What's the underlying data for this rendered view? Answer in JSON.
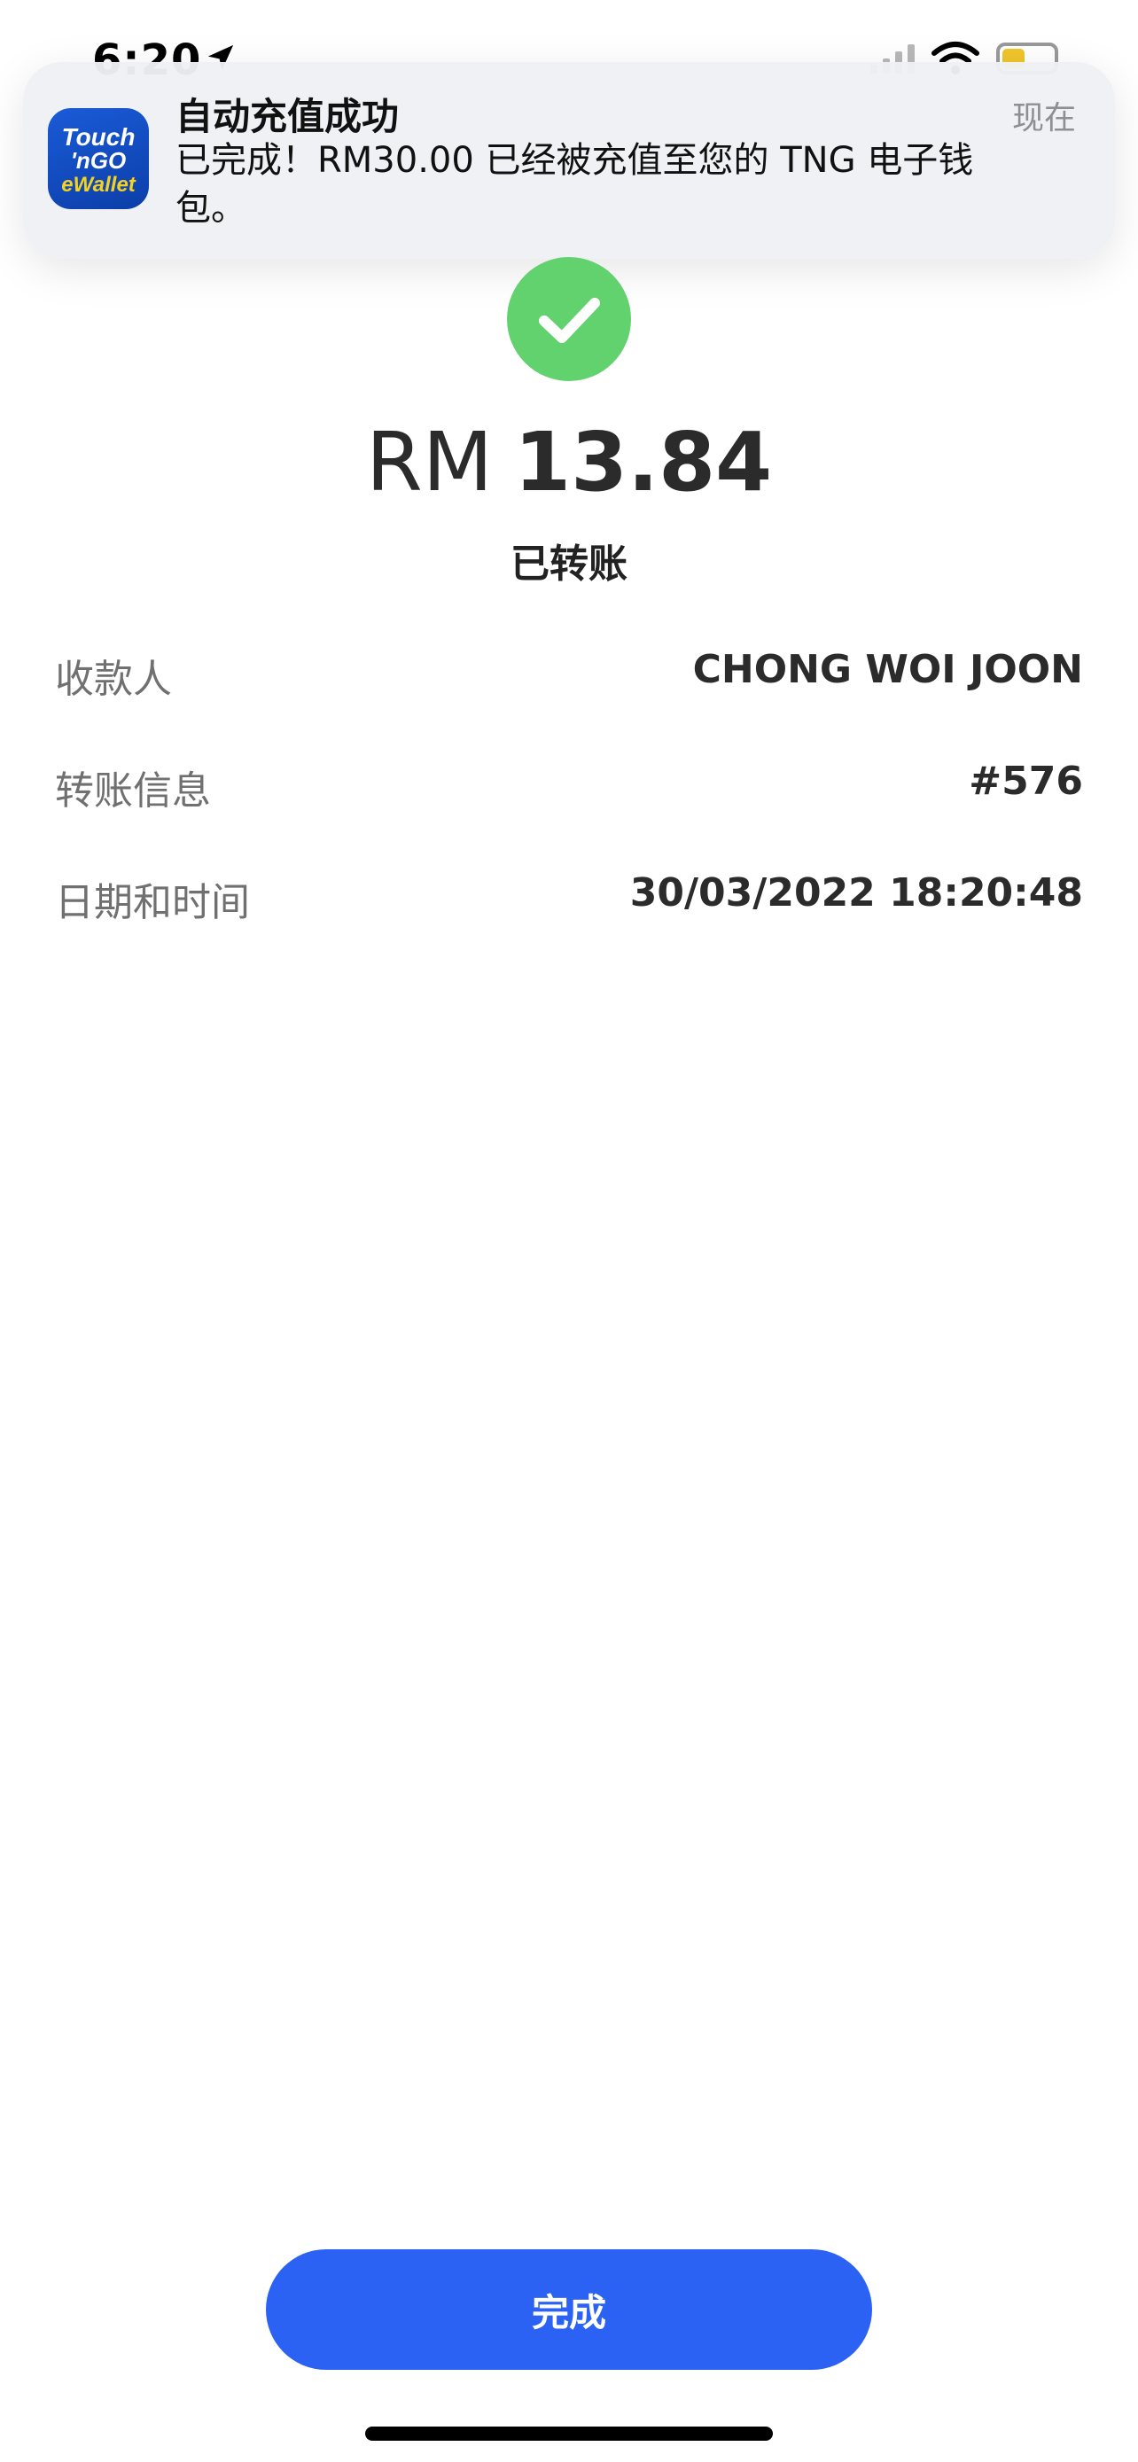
{
  "status_bar": {
    "time": "6:20"
  },
  "notification": {
    "app_icon_text": [
      "Touch",
      "'nGO",
      "eWallet"
    ],
    "title": "自动充值成功",
    "time": "现在",
    "body": "已完成！RM30.00 已经被充值至您的 TNG 电子钱包。"
  },
  "transaction": {
    "currency": "RM",
    "amount": "13.84",
    "status": "已转账"
  },
  "details": [
    {
      "label": "收款人",
      "value": "CHONG WOI JOON"
    },
    {
      "label": "转账信息",
      "value": "#576"
    },
    {
      "label": "日期和时间",
      "value": "30/03/2022 18:20:48"
    }
  ],
  "actions": {
    "done_label": "完成"
  },
  "colors": {
    "success_green": "#62d26f",
    "primary_blue": "#2b62f4",
    "brand_blue": "#0c3ea8",
    "brand_yellow": "#f5d21f"
  },
  "icons": {
    "success": "checkmark-icon",
    "location": "location-arrow-icon",
    "signal": "cellular-signal-icon",
    "wifi": "wifi-icon",
    "battery": "battery-icon"
  }
}
